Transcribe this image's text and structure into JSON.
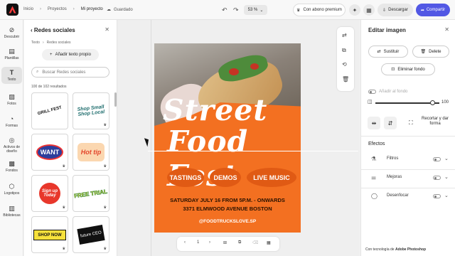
{
  "topbar": {
    "breadcrumb": [
      "Inicio",
      "Proyectos",
      "Mi proyecto"
    ],
    "saved_label": "Guardado",
    "zoom": "53 %",
    "premium_label": "Con abono premium",
    "download_label": "Descargar",
    "share_label": "Compartir",
    "accent": "#5258e4"
  },
  "rail": {
    "items": [
      {
        "label": "Descubrir",
        "icon": "compass-icon"
      },
      {
        "label": "Plantillas",
        "icon": "template-icon"
      },
      {
        "label": "Texto",
        "icon": "text-icon"
      },
      {
        "label": "Fotos",
        "icon": "photo-icon"
      },
      {
        "label": "Formas",
        "icon": "shapes-icon"
      },
      {
        "label": "Activos de diseño",
        "icon": "assets-icon"
      },
      {
        "label": "Fondos",
        "icon": "background-icon"
      },
      {
        "label": "Logotipos",
        "icon": "logo-icon"
      },
      {
        "label": "Bibliotecas",
        "icon": "library-icon"
      }
    ]
  },
  "panel": {
    "title": "Redes sociales",
    "breadcrumb": [
      "Texto",
      "Redes sociales"
    ],
    "add_text_label": "Añadir texto propio",
    "search_placeholder": "Buscar Redes sociales",
    "results": "100 de 102 resultados",
    "stickers": [
      {
        "text": "GRILL FEST",
        "premium": false
      },
      {
        "text": "Shop Small Shop Local",
        "premium": true
      },
      {
        "text": "WANT",
        "premium": true
      },
      {
        "text": "Hot tip",
        "premium": true
      },
      {
        "text": "Sign up Today",
        "premium": true
      },
      {
        "text": "FREE TRIAL",
        "premium": true
      },
      {
        "text": "SHOP NOW",
        "premium": true
      },
      {
        "text": "future CEO",
        "premium": true
      }
    ]
  },
  "poster": {
    "title_line1": "Street",
    "title_line2": "Food Fest",
    "pills": [
      "TASTINGS",
      "DEMOS",
      "LIVE MUSIC"
    ],
    "date_line": "SATURDAY JULY 16 FROM 5P.M. - ONWARDS",
    "address_line": "3371 ELMWOOD AVENUE BOSTON",
    "handle": "@FOODTRUCKSLOVE.SP",
    "bg": "#f37021"
  },
  "pager": {
    "page": "1"
  },
  "right": {
    "title": "Editar imagen",
    "replace_label": "Sustituir",
    "delete_label": "Delete",
    "remove_bg_label": "Eliminar fondo",
    "add_bg_label": "Añadir al fondo",
    "opacity_value": "100",
    "crop_label": "Recortar y dar forma",
    "effects_title": "Efectos",
    "effects": [
      "Filtros",
      "Mejoras",
      "Desenfocar"
    ],
    "footer_prefix": "Con tecnología de",
    "footer_brand": "Adobe Photoshop"
  }
}
